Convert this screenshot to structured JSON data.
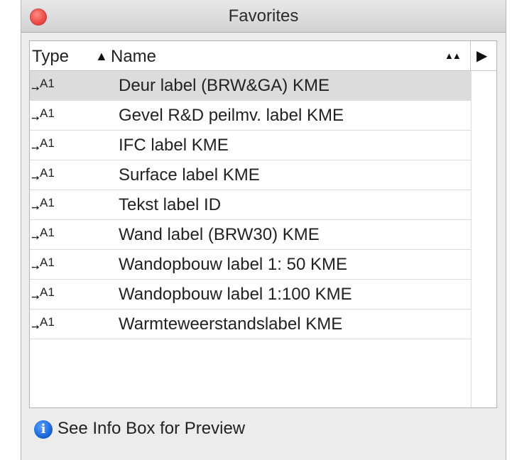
{
  "window": {
    "title": "Favorites"
  },
  "table": {
    "columns": {
      "type": "Type",
      "name": "Name"
    },
    "sort_indicator": "▲",
    "sort_toggle": "▲▲",
    "expand_arrow": "▶",
    "rows": [
      {
        "icon": "label-tool-icon",
        "type_text": "A1",
        "name": "Deur label (BRW&GA) KME",
        "selected": true
      },
      {
        "icon": "label-tool-icon",
        "type_text": "A1",
        "name": "Gevel R&D peilmv. label KME"
      },
      {
        "icon": "label-tool-icon",
        "type_text": "A1",
        "name": "IFC label KME"
      },
      {
        "icon": "label-tool-icon",
        "type_text": "A1",
        "name": "Surface label KME"
      },
      {
        "icon": "label-tool-icon",
        "type_text": "A1",
        "name": "Tekst label ID"
      },
      {
        "icon": "label-tool-icon",
        "type_text": "A1",
        "name": "Wand label (BRW30) KME"
      },
      {
        "icon": "label-tool-icon",
        "type_text": "A1",
        "name": "Wandopbouw label 1: 50 KME"
      },
      {
        "icon": "label-tool-icon",
        "type_text": "A1",
        "name": "Wandopbouw label 1:100 KME"
      },
      {
        "icon": "label-tool-icon",
        "type_text": "A1",
        "name": "Warmteweerstandslabel KME"
      }
    ]
  },
  "footer": {
    "info_text": "See Info Box for Preview",
    "info_icon_glyph": "i"
  }
}
